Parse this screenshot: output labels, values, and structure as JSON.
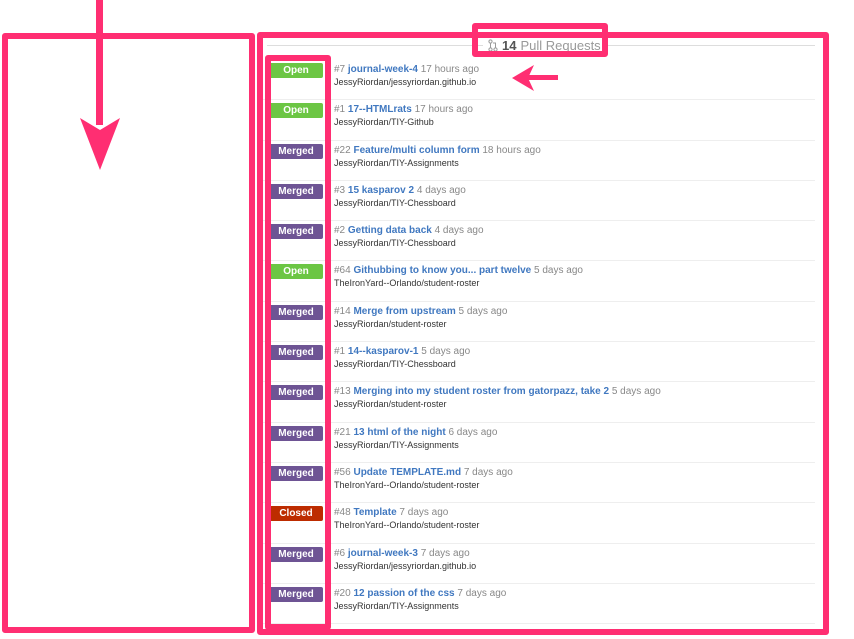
{
  "header": {
    "count": "14",
    "label": "Pull Requests"
  },
  "colors": {
    "open": "#6cc644",
    "merged": "#6e5494",
    "closed": "#bd2c00",
    "annotation": "#ff2e72"
  },
  "pull_requests": [
    {
      "status": "Open",
      "type": "open",
      "number": "#7",
      "title": "journal-week-4",
      "time": "17 hours ago",
      "repo": "JessyRiordan/jessyriordan.github.io"
    },
    {
      "status": "Open",
      "type": "open",
      "number": "#1",
      "title": "17--HTMLrats",
      "time": "17 hours ago",
      "repo": "JessyRiordan/TIY-Github"
    },
    {
      "status": "Merged",
      "type": "merged",
      "number": "#22",
      "title": "Feature/multi column form",
      "time": "18 hours ago",
      "repo": "JessyRiordan/TIY-Assignments"
    },
    {
      "status": "Merged",
      "type": "merged",
      "number": "#3",
      "title": "15 kasparov 2",
      "time": "4 days ago",
      "repo": "JessyRiordan/TIY-Chessboard"
    },
    {
      "status": "Merged",
      "type": "merged",
      "number": "#2",
      "title": "Getting data back",
      "time": "4 days ago",
      "repo": "JessyRiordan/TIY-Chessboard"
    },
    {
      "status": "Open",
      "type": "open",
      "number": "#64",
      "title": "Githubbing to know you... part twelve",
      "time": "5 days ago",
      "repo": "TheIronYard--Orlando/student-roster"
    },
    {
      "status": "Merged",
      "type": "merged",
      "number": "#14",
      "title": "Merge from upstream",
      "time": "5 days ago",
      "repo": "JessyRiordan/student-roster"
    },
    {
      "status": "Merged",
      "type": "merged",
      "number": "#1",
      "title": "14--kasparov-1",
      "time": "5 days ago",
      "repo": "JessyRiordan/TIY-Chessboard"
    },
    {
      "status": "Merged",
      "type": "merged",
      "number": "#13",
      "title": "Merging into my student roster from gatorpazz, take 2",
      "time": "5 days ago",
      "repo": "JessyRiordan/student-roster"
    },
    {
      "status": "Merged",
      "type": "merged",
      "number": "#21",
      "title": "13 html of the night",
      "time": "6 days ago",
      "repo": "JessyRiordan/TIY-Assignments"
    },
    {
      "status": "Merged",
      "type": "merged",
      "number": "#56",
      "title": "Update TEMPLATE.md",
      "time": "7 days ago",
      "repo": "TheIronYard--Orlando/student-roster"
    },
    {
      "status": "Closed",
      "type": "closed",
      "number": "#48",
      "title": "Template",
      "time": "7 days ago",
      "repo": "TheIronYard--Orlando/student-roster"
    },
    {
      "status": "Merged",
      "type": "merged",
      "number": "#6",
      "title": "journal-week-3",
      "time": "7 days ago",
      "repo": "JessyRiordan/jessyriordan.github.io"
    },
    {
      "status": "Merged",
      "type": "merged",
      "number": "#20",
      "title": "12 passion of the css",
      "time": "7 days ago",
      "repo": "JessyRiordan/TIY-Assignments"
    }
  ]
}
